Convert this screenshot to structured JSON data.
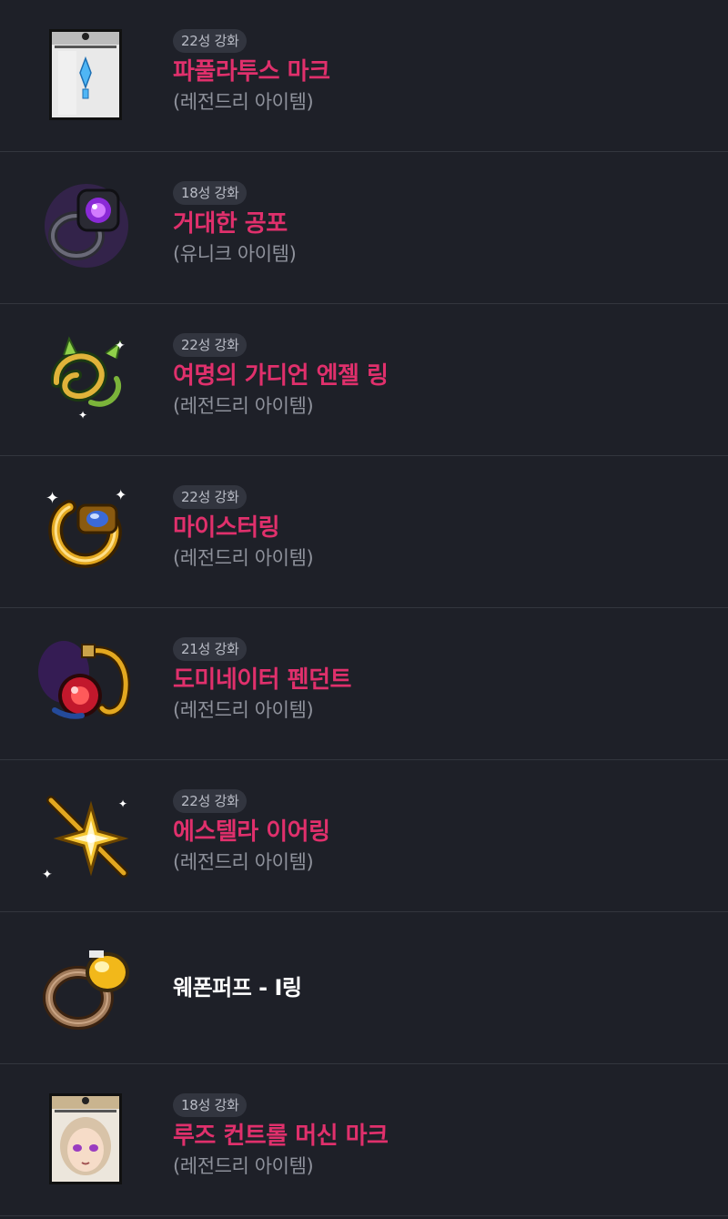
{
  "items": [
    {
      "stars": "22성 강화",
      "name": "파풀라투스 마크",
      "grade": "(레전드리 아이템)",
      "icon": "papulatus-mark-icon"
    },
    {
      "stars": "18성 강화",
      "name": "거대한 공포",
      "grade": "(유니크 아이템)",
      "icon": "giant-fear-ring-icon"
    },
    {
      "stars": "22성 강화",
      "name": "여명의 가디언 엔젤 링",
      "grade": "(레전드리 아이템)",
      "icon": "guardian-angel-ring-icon"
    },
    {
      "stars": "22성 강화",
      "name": "마이스터링",
      "grade": "(레전드리 아이템)",
      "icon": "meister-ring-icon"
    },
    {
      "stars": "21성 강화",
      "name": "도미네이터 펜던트",
      "grade": "(레전드리 아이템)",
      "icon": "dominator-pendant-icon"
    },
    {
      "stars": "22성 강화",
      "name": "에스텔라 이어링",
      "grade": "(레전드리 아이템)",
      "icon": "estella-earring-icon"
    },
    {
      "stars": "",
      "name": "웨폰퍼프 - I링",
      "grade": "",
      "icon": "weapon-puff-ring-icon"
    },
    {
      "stars": "18성 강화",
      "name": "루즈 컨트롤 머신 마크",
      "grade": "(레전드리 아이템)",
      "icon": "lucid-control-machine-mark-icon"
    }
  ],
  "colors": {
    "background": "#1e2028",
    "divider": "#33363e",
    "item_name": "#e0306c",
    "badge_bg": "#32353f",
    "grade_text": "#8e919b"
  }
}
